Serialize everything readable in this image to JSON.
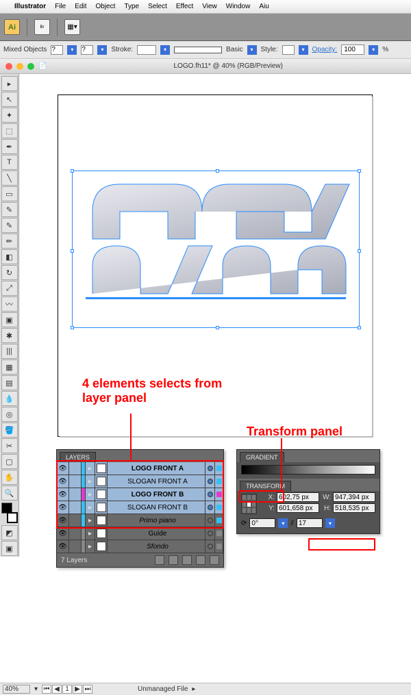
{
  "menubar": {
    "app": "Illustrator",
    "items": [
      "File",
      "Edit",
      "Object",
      "Type",
      "Select",
      "Effect",
      "View",
      "Window",
      "Aiu"
    ]
  },
  "toolbar": {
    "ai": "Ai",
    "br": "Br"
  },
  "controlbar": {
    "selection": "Mixed Objects",
    "stroke_label": "Stroke:",
    "style_label": "Style:",
    "opacity_label": "Opacity:",
    "opacity_value": "100",
    "basic": "Basic",
    "percent": "%"
  },
  "window": {
    "title": "LOGO.fh11* @ 40% (RGB/Preview)"
  },
  "annotations": {
    "a1": "4 elements selects from layer panel",
    "a2": "Transform panel"
  },
  "layers_panel": {
    "tab": "LAYERS",
    "footer": "7 Layers",
    "rows": [
      {
        "name": "LOGO FRONT A",
        "bold": true,
        "sel": true,
        "bar": "#37c0f4",
        "clr": "#37c0f4",
        "selected": true
      },
      {
        "name": "SLOGAN FRONT A",
        "bold": false,
        "sel": true,
        "bar": "#37c0f4",
        "clr": "#37c0f4",
        "selected": true
      },
      {
        "name": "LOGO FRONT B",
        "bold": true,
        "sel": true,
        "bar": "#e03bd0",
        "clr": "#e03bd0",
        "selected": true
      },
      {
        "name": "SLOGAN FRONT B",
        "bold": false,
        "sel": true,
        "bar": "#37c0f4",
        "clr": "#37c0f4",
        "selected": true
      },
      {
        "name": "Primo piano",
        "bold": false,
        "sel": false,
        "bar": "#37c0f4",
        "clr": "#37c0f4",
        "selected": false,
        "italic": true
      },
      {
        "name": "Guide",
        "bold": false,
        "sel": false,
        "bar": "#888",
        "clr": "#888",
        "selected": false
      },
      {
        "name": "Sfondo",
        "bold": false,
        "sel": false,
        "bar": "#888",
        "clr": "#888",
        "selected": false,
        "italic": true
      }
    ]
  },
  "gradient_panel": {
    "tab": "GRADIENT"
  },
  "transform_panel": {
    "tab": "TRANSFORM",
    "x_label": "X:",
    "x": "602,75 px",
    "y_label": "Y:",
    "y": "601,658 px",
    "w_label": "W:",
    "w": "947,394 px",
    "h_label": "H:",
    "h": "518,535 px",
    "angle_label": "",
    "angle": "0°",
    "shear_label": "",
    "shear": "17"
  },
  "statusbar": {
    "zoom": "40%",
    "page": "1",
    "status": "Unmanaged File"
  },
  "tools": [
    "▸",
    "↖",
    "✦",
    "⬚",
    "T",
    "╲",
    "✎",
    "✎",
    "✂",
    "↻",
    "⟲",
    "▦",
    "◫",
    "▤",
    "|||",
    "◐",
    "⟋",
    "◔",
    "⌀",
    "✥",
    "✋",
    "🔍"
  ]
}
